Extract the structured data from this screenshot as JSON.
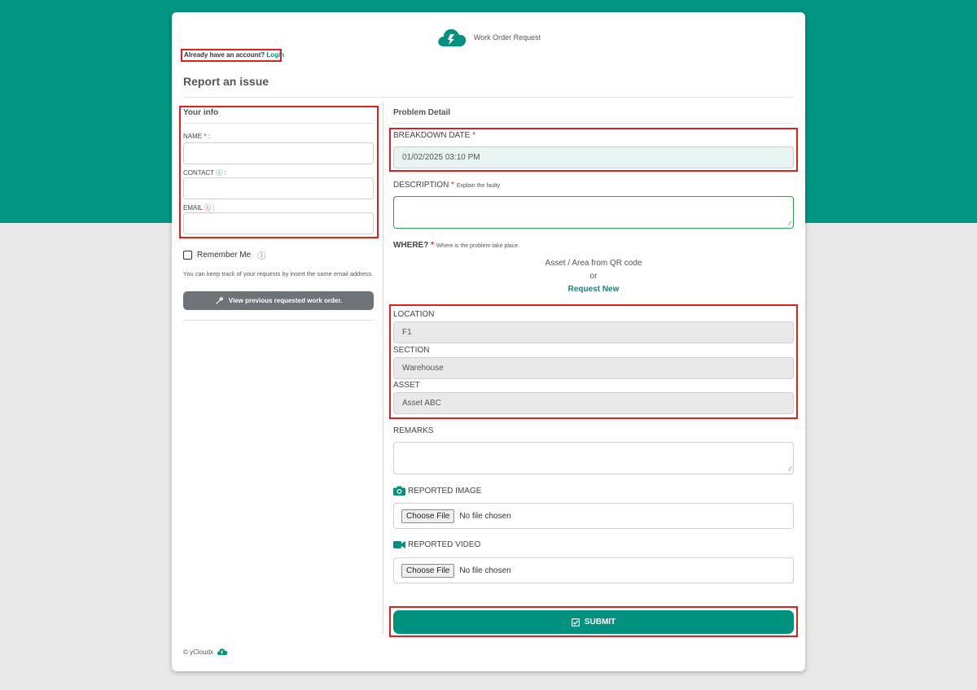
{
  "header": {
    "app_title": "Work Order Request",
    "logo_icon": "cloud-bolt-icon"
  },
  "login": {
    "prompt": "Already have an account?",
    "link_label": "Login"
  },
  "page_title": "Report an issue",
  "your_info": {
    "title": "Your info",
    "name_label": "NAME",
    "name_required": "*",
    "name_suffix": ":",
    "name_value": "",
    "contact_label": "CONTACT",
    "contact_suffix": ":",
    "contact_value": "",
    "email_label": "EMAIL",
    "email_suffix": ":",
    "email_value": ""
  },
  "remember": {
    "label": "Remember Me",
    "checked": false,
    "help_text": "You can keep track of your requests by insert the same email address.",
    "view_button_label": "View previous requested work order."
  },
  "problem": {
    "title": "Problem Detail",
    "breakdown_label": "BREAKDOWN DATE",
    "breakdown_value": "01/02/2025 03:10 PM",
    "description_label": "DESCRIPTION",
    "description_hint": "Explain the faulty",
    "description_value": "",
    "where_label": "WHERE?",
    "where_hint": "Where is the problem take place.",
    "qr_text": "Asset / Area from QR code",
    "or_text": "or",
    "request_new_label": "Request New",
    "location_label": "LOCATION",
    "location_value": "F1",
    "section_label": "SECTION",
    "section_value": "Warehouse",
    "asset_label": "ASSET",
    "asset_value": "Asset ABC",
    "remarks_label": "REMARKS",
    "remarks_value": "",
    "image_label": "REPORTED IMAGE",
    "video_label": "REPORTED VIDEO",
    "choose_file_label": "Choose File",
    "no_file_text": "No file chosen",
    "submit_label": "SUBMIT"
  },
  "footer": {
    "copyright": "© yCloudx"
  },
  "colors": {
    "brand": "#00917f",
    "header_band": "#009681",
    "required": "#e02020",
    "highlight_box": "#e02020"
  }
}
